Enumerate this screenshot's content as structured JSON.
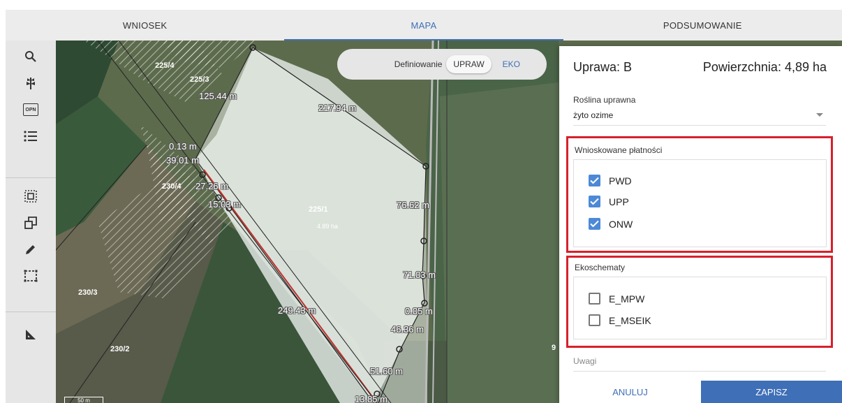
{
  "tabs": [
    {
      "label": "WNIOSEK"
    },
    {
      "label": "MAPA"
    },
    {
      "label": "PODSUMOWANIE"
    }
  ],
  "toolbar": {
    "tools": [
      "search-icon",
      "plant-icon",
      "opn-icon",
      "list-icon",
      "select-area-icon",
      "copy-shape-icon",
      "pencil-icon",
      "dashed-rectangle-icon",
      "ruler-icon"
    ],
    "opn_text": "OPN"
  },
  "map": {
    "parcel_labels": [
      "225/4",
      "225/3",
      "230/4",
      "225/1",
      "230/3",
      "230/2",
      "9"
    ],
    "area_label": "4.89 ha",
    "measurements": [
      "125.44 m",
      "217.94 m",
      "0.13 m",
      "39.01 m",
      "27.26 m",
      "15.03 m",
      "76.62 m",
      "71.03 m",
      "0.05 m",
      "46.36 m",
      "249.43 m",
      "51.60 m",
      "13.85 m"
    ],
    "scale_label": "50 m"
  },
  "define_pill": {
    "label": "Definiowanie",
    "options": [
      "UPRAW",
      "EKO"
    ]
  },
  "panel": {
    "title": "Uprawa: B",
    "area": "Powierzchnia: 4,89 ha",
    "plant_label": "Roślina uprawna",
    "plant_value": "żyto ozime",
    "payments_title": "Wnioskowane płatności",
    "payments": [
      {
        "label": "PWD",
        "checked": true
      },
      {
        "label": "UPP",
        "checked": true
      },
      {
        "label": "ONW",
        "checked": true
      }
    ],
    "eco_title": "Ekoschematy",
    "eco": [
      {
        "label": "E_MPW",
        "checked": false
      },
      {
        "label": "E_MSEIK",
        "checked": false
      }
    ],
    "notes_placeholder": "Uwagi",
    "cancel_label": "ANULUJ",
    "save_label": "ZAPISZ"
  },
  "colors": {
    "accent": "#3f6fb6",
    "checkbox": "#4d89d6",
    "highlight": "#d8202c"
  }
}
